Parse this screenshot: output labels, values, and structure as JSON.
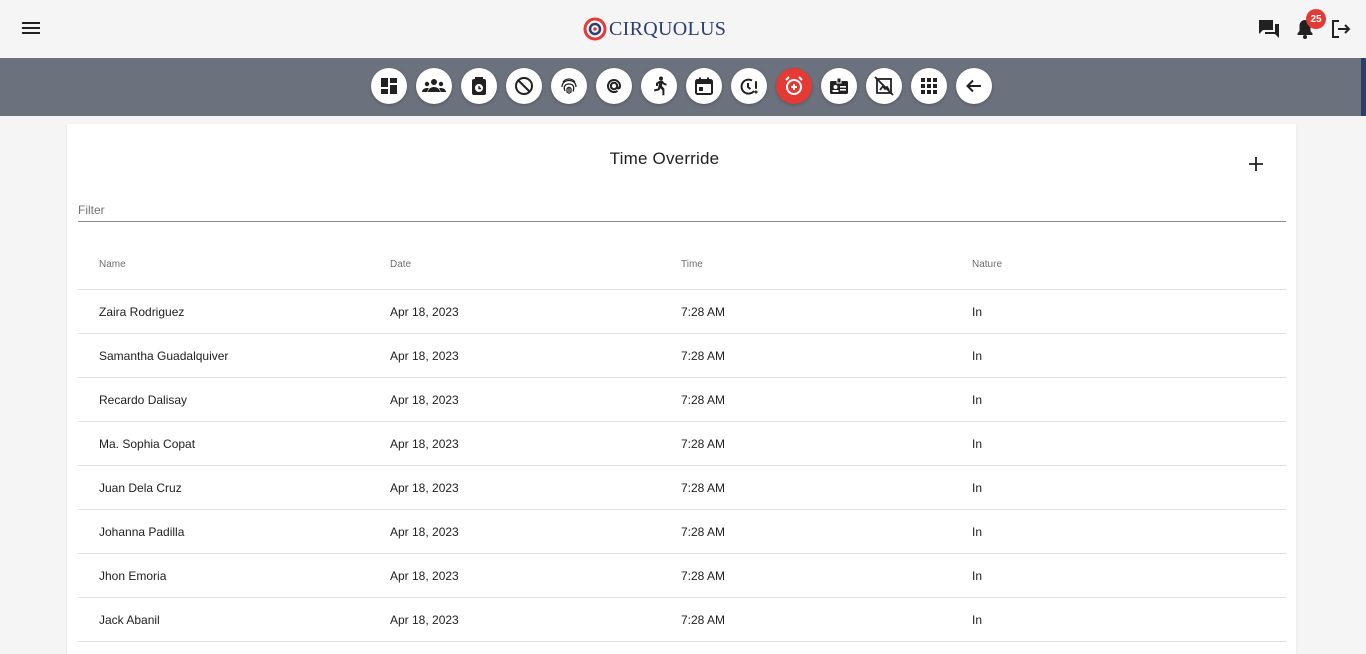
{
  "header": {
    "logo_text": "CIRQUOLUS",
    "notification_count": "25",
    "brand_color": "#2c3e6b",
    "accent_color": "#e53935"
  },
  "toolbar": {
    "icons": [
      "dashboard-icon",
      "groups-icon",
      "time-clock-icon",
      "blocked-icon",
      "fingerprint-icon",
      "at-sign-icon",
      "running-person-icon",
      "calendar-icon",
      "timer-alert-icon",
      "alarm-add-icon",
      "id-badge-icon",
      "no-picture-icon",
      "apps-grid-icon",
      "arrow-back-icon"
    ],
    "active": "alarm-add-icon"
  },
  "page": {
    "title": "Time Override",
    "filter_placeholder": "Filter"
  },
  "table": {
    "columns": [
      "Name",
      "Date",
      "Time",
      "Nature"
    ],
    "rows": [
      [
        "Zaira Rodriguez",
        "Apr 18, 2023",
        "7:28 AM",
        "In"
      ],
      [
        "Samantha Guadalquiver",
        "Apr 18, 2023",
        "7:28 AM",
        "In"
      ],
      [
        "Recardo Dalisay",
        "Apr 18, 2023",
        "7:28 AM",
        "In"
      ],
      [
        "Ma. Sophia Copat",
        "Apr 18, 2023",
        "7:28 AM",
        "In"
      ],
      [
        "Juan Dela Cruz",
        "Apr 18, 2023",
        "7:28 AM",
        "In"
      ],
      [
        "Johanna Padilla",
        "Apr 18, 2023",
        "7:28 AM",
        "In"
      ],
      [
        "Jhon Emoria",
        "Apr 18, 2023",
        "7:28 AM",
        "In"
      ],
      [
        "Jack Abanil",
        "Apr 18, 2023",
        "7:28 AM",
        "In"
      ]
    ]
  }
}
